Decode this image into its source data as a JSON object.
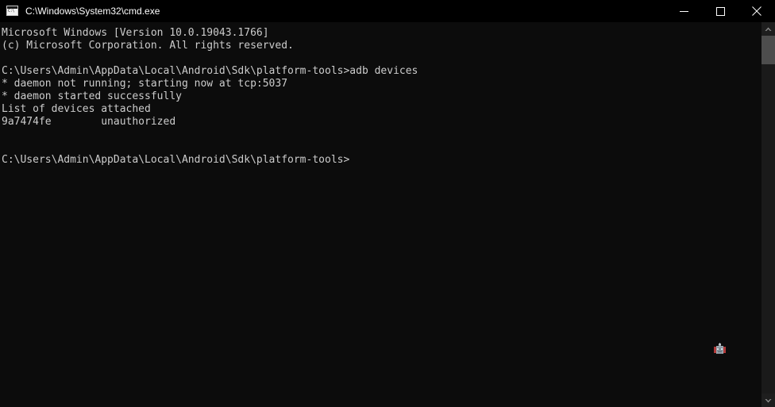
{
  "window": {
    "title": "C:\\Windows\\System32\\cmd.exe",
    "icon": "cmd-console-icon",
    "icon_glyph": "C:\\",
    "background_color": "#0c0c0c",
    "titlebar_color": "#000000",
    "text_color": "#cccccc"
  },
  "titlebar_buttons": {
    "minimize": "minimize-button",
    "maximize": "maximize-button",
    "close": "close-button"
  },
  "console": {
    "lines": [
      "Microsoft Windows [Version 10.0.19043.1766]",
      "(c) Microsoft Corporation. All rights reserved.",
      "",
      "C:\\Users\\Admin\\AppData\\Local\\Android\\Sdk\\platform-tools>adb devices",
      "* daemon not running; starting now at tcp:5037",
      "* daemon started successfully",
      "List of devices attached",
      "9a7474fe        unauthorized",
      "",
      "",
      "C:\\Users\\Admin\\AppData\\Local\\Android\\Sdk\\platform-tools>"
    ],
    "command": "adb devices",
    "prompt_path": "C:\\Users\\Admin\\AppData\\Local\\Android\\Sdk\\platform-tools>",
    "device_serial": "9a7474fe",
    "device_status": "unauthorized",
    "daemon_port": "tcp:5037",
    "windows_version": "10.0.19043.1766"
  },
  "scrollbar": {
    "up_arrow": "scroll-up-arrow-icon",
    "down_arrow": "scroll-down-arrow-icon",
    "thumb": "scrollbar-thumb"
  },
  "overlay": {
    "robot_icon": "robot-head-icon"
  }
}
